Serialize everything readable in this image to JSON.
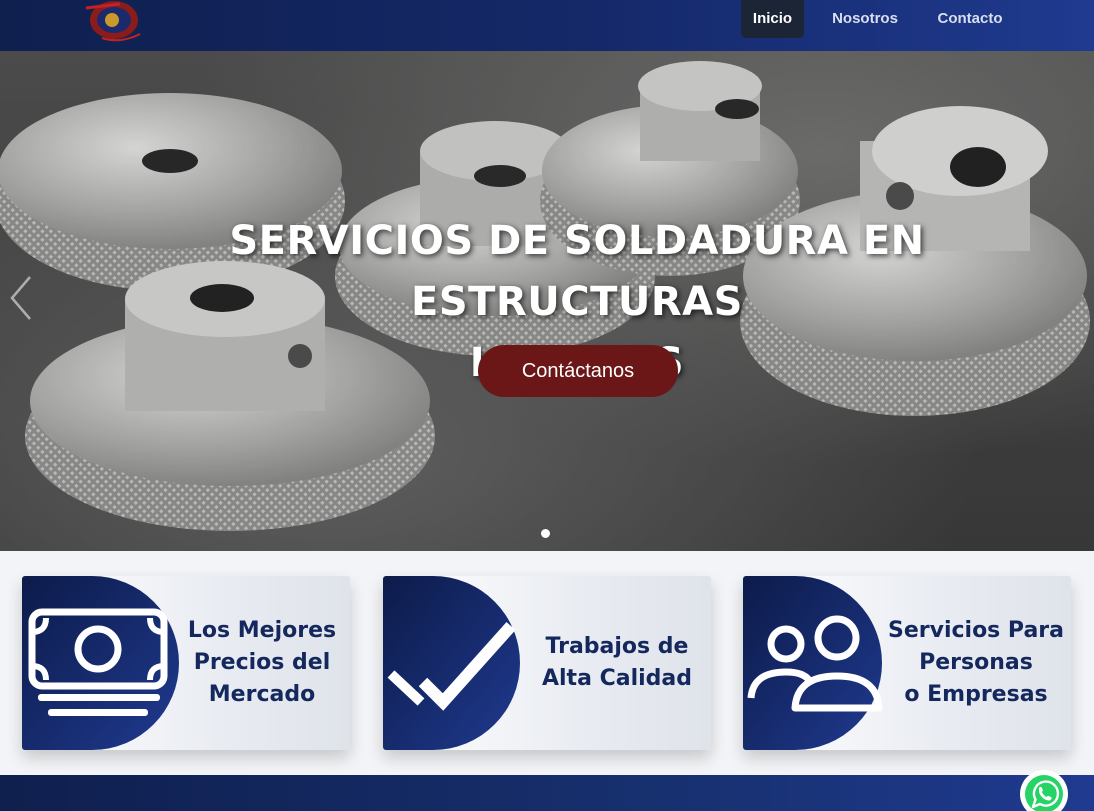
{
  "nav": {
    "items": [
      {
        "label": "Inicio",
        "active": true
      },
      {
        "label": "Nosotros",
        "active": false
      },
      {
        "label": "Contacto",
        "active": false
      }
    ]
  },
  "hero": {
    "title_line1": "SERVICIOS DE SOLDADURA EN ESTRUCTURAS",
    "title_line2": "LIVIANAS",
    "button_label": "Contáctanos",
    "slide_count": 1,
    "active_slide": 1
  },
  "features": [
    {
      "line1": "Los Mejores",
      "line2": "Precios del",
      "line3": "Mercado",
      "icon": "money-icon"
    },
    {
      "line1": "Trabajos de",
      "line2": "Alta Calidad",
      "icon": "check-icon"
    },
    {
      "line1": "Servicios Para",
      "line2": "Personas",
      "line3": "o Empresas",
      "icon": "users-icon"
    }
  ],
  "colors": {
    "navy": "#14285e",
    "nav_gradient_end": "#1f3a8f",
    "cta": "#6b1717",
    "whatsapp": "#25d366"
  }
}
